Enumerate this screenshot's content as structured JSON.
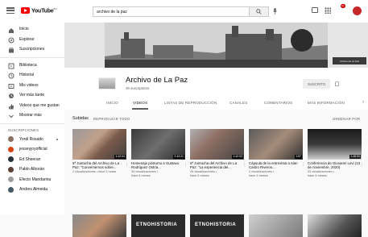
{
  "topbar": {
    "logo_text": "YouTube",
    "logo_region": "BO",
    "search_value": "archivo de la paz",
    "notification_count": "9+"
  },
  "sidebar": {
    "main_items": [
      {
        "label": "Inicio",
        "icon": "home-icon"
      },
      {
        "label": "Explorar",
        "icon": "compass-icon"
      },
      {
        "label": "Suscripciones",
        "icon": "subscriptions-icon"
      }
    ],
    "library_items": [
      {
        "label": "Biblioteca",
        "icon": "library-icon"
      },
      {
        "label": "Historial",
        "icon": "history-icon"
      },
      {
        "label": "Mis videos",
        "icon": "my-videos-icon"
      },
      {
        "label": "Ver más tarde",
        "icon": "watch-later-icon"
      },
      {
        "label": "Videos que me gustan",
        "icon": "liked-icon"
      },
      {
        "label": "Mostrar más",
        "icon": "chevron-down-icon"
      }
    ],
    "subscriptions_header": "SUSCRIPCIONES",
    "subscriptions": [
      {
        "label": "Yordi Rosado",
        "color": "#8d6e63",
        "dot": true
      },
      {
        "label": "jesseyjoyofficial",
        "color": "#d84315"
      },
      {
        "label": "Ed Sheeran",
        "color": "#263238"
      },
      {
        "label": "Pablo Alborán",
        "color": "#5d4037"
      },
      {
        "label": "Efecto Mandarina",
        "color": "#9e9e9e"
      },
      {
        "label": "Andres Almeida",
        "color": "#455a64"
      }
    ]
  },
  "banner": {
    "badge_text": "Archivo de La Paz"
  },
  "channel": {
    "name": "Archivo de La Paz",
    "subscribers": "49 suscriptores",
    "subscribe_label": "SUSCRITO",
    "tabs": [
      "INICIO",
      "VIDEOS",
      "LISTAS DE REPRODUCCIÓN",
      "CANALES",
      "COMENTARIOS",
      "MÁS INFORMACIÓN"
    ],
    "active_tab": "VIDEOS"
  },
  "section": {
    "title": "Subidas",
    "play_all": "REPRODUCIR TODO",
    "sort": "ORDENAR POR"
  },
  "videos": [
    {
      "title": "6ª Juntucha del Archivo de La Paz: \"Conversemos sobre...",
      "meta1": "2 visualizaciones • hace 5 horas",
      "meta2": "",
      "duration": "1:42:04"
    },
    {
      "title": "Homenaje póstumo a Gustavo Rodríguez Ostria...",
      "meta1": "34 visualizaciones •",
      "meta2": "hace 4 meses",
      "duration": "2:43:21"
    },
    {
      "title": "5ª Juntucha del Archivo de La Paz: \"La experiencia del...",
      "meta1": "26 visualizaciones •",
      "meta2": "hace 4 meses",
      "duration": "1:42:03"
    },
    {
      "title": "Cápsula de la entrevista a Alan Castro Riveros...",
      "meta1": "2 visualizaciones •",
      "meta2": "hace 4 meses",
      "duration": "1:57"
    },
    {
      "title": "Conferencia de Giovanni Levi (13 de noviembre, 2020)",
      "meta1": "33 visualizaciones •",
      "meta2": "hace 4 meses",
      "duration": "1:48:53"
    }
  ],
  "second_row_thumb_texts": [
    "",
    "ETNOHISTORIA",
    "ETNOHISTORIA",
    "",
    ""
  ]
}
